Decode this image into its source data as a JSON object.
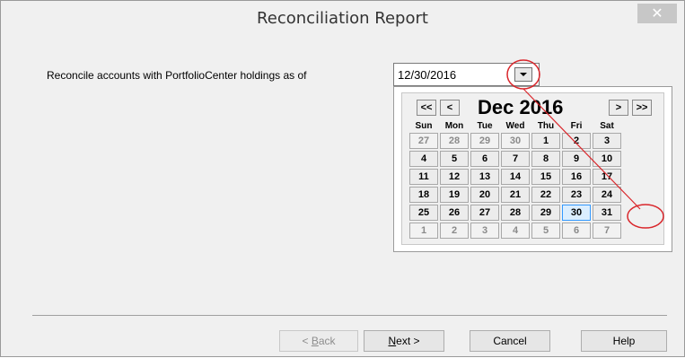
{
  "window": {
    "title": "Reconciliation Report",
    "close_glyph": "✕"
  },
  "form": {
    "prompt": "Reconcile accounts with PortfolioCenter holdings as of",
    "date_value": "12/30/2016"
  },
  "calendar": {
    "month_label": "Dec 2016",
    "nav": {
      "prev_year": "<<",
      "prev_month": "<",
      "next_month": ">",
      "next_year": ">>"
    },
    "weekdays": [
      "Sun",
      "Mon",
      "Tue",
      "Wed",
      "Thu",
      "Fri",
      "Sat"
    ],
    "weeks": [
      [
        "27",
        "28",
        "29",
        "30",
        "1",
        "2",
        "3"
      ],
      [
        "4",
        "5",
        "6",
        "7",
        "8",
        "9",
        "10"
      ],
      [
        "11",
        "12",
        "13",
        "14",
        "15",
        "16",
        "17"
      ],
      [
        "18",
        "19",
        "20",
        "21",
        "22",
        "23",
        "24"
      ],
      [
        "25",
        "26",
        "27",
        "28",
        "29",
        "30",
        "31"
      ],
      [
        "1",
        "2",
        "3",
        "4",
        "5",
        "6",
        "7"
      ]
    ],
    "selected_day": "30",
    "highlighted_day": "31"
  },
  "buttons": {
    "back": {
      "label_prefix": "< ",
      "mnemonic": "B",
      "label_rest": "ack"
    },
    "next": {
      "mnemonic": "N",
      "label_rest": "ext >"
    },
    "cancel": "Cancel",
    "help": "Help"
  },
  "colors": {
    "annotation": "#d9262b",
    "selected_day_bg": "#dbeeff"
  }
}
